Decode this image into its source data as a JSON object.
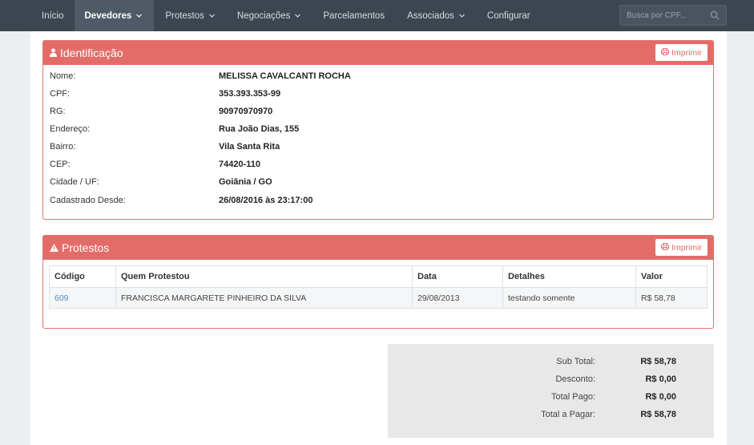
{
  "nav": {
    "items": [
      {
        "label": "Início",
        "dropdown": false
      },
      {
        "label": "Devedores",
        "dropdown": true,
        "active": true
      },
      {
        "label": "Protestos",
        "dropdown": true
      },
      {
        "label": "Negociações",
        "dropdown": true
      },
      {
        "label": "Parcelamentos",
        "dropdown": false
      },
      {
        "label": "Associados",
        "dropdown": true
      },
      {
        "label": "Configurar",
        "dropdown": false
      }
    ],
    "search_placeholder": "Busca por CPF..."
  },
  "identificacao": {
    "title": "Identificação",
    "print_label": "Imprimir",
    "fields": [
      {
        "label": "Nome:",
        "value": "MELISSA CAVALCANTI ROCHA"
      },
      {
        "label": "CPF:",
        "value": "353.393.353-99"
      },
      {
        "label": "RG:",
        "value": "90970970970"
      },
      {
        "label": "Endereço:",
        "value": "Rua João Dias, 155"
      },
      {
        "label": "Bairro:",
        "value": "Vila Santa Rita"
      },
      {
        "label": "CEP:",
        "value": "74420-110"
      },
      {
        "label": "Cidade / UF:",
        "value": "Goiânia / GO"
      },
      {
        "label": "Cadastrado Desde:",
        "value": "26/08/2016 às 23:17:00"
      }
    ]
  },
  "protestos": {
    "title": "Protestos",
    "print_label": "Imprimir",
    "columns": [
      "Código",
      "Quem Protestou",
      "Data",
      "Detalhes",
      "Valor"
    ],
    "rows": [
      {
        "codigo": "609",
        "quem": "FRANCISCA MARGARETE PINHEIRO DA SILVA",
        "data": "29/08/2013",
        "detalhes": "testando somente",
        "valor": "R$ 58,78"
      }
    ]
  },
  "totals": [
    {
      "label": "Sub Total:",
      "value": "R$ 58,78"
    },
    {
      "label": "Desconto:",
      "value": "R$ 0,00"
    },
    {
      "label": "Total Pago:",
      "value": "R$ 0,00"
    },
    {
      "label": "Total a Pagar:",
      "value": "R$ 58,78"
    }
  ],
  "colors": {
    "navbar": "#3c4650",
    "panel_header": "#e36c69",
    "link": "#4a90c8"
  }
}
